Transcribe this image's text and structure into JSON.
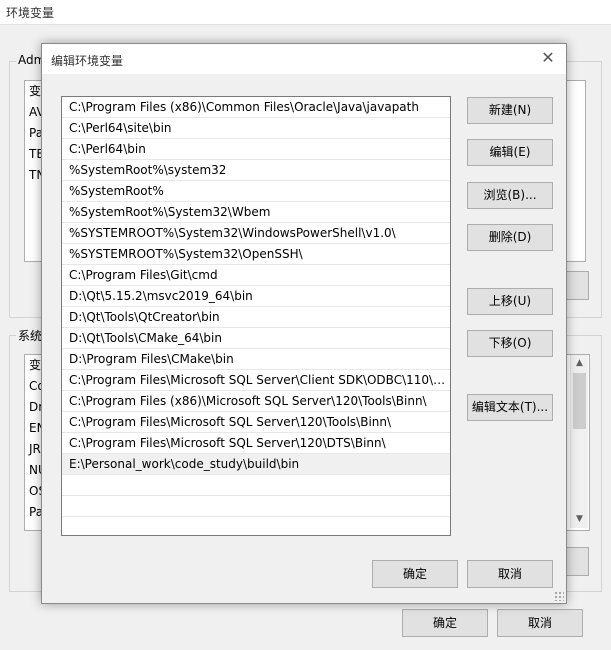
{
  "parent_window": {
    "title": "环境变量",
    "user_group_label": "Adm",
    "user_list": [
      "变",
      "AV",
      "Pa",
      "TE",
      "TN"
    ],
    "system_group_label": "系统",
    "system_list": [
      "变",
      "Co",
      "Dr",
      "EN",
      "JR",
      "NU",
      "OS",
      "Pa"
    ],
    "ok_label": "确定",
    "cancel_label": "取消"
  },
  "dialog": {
    "title": "编辑环境变量",
    "close_glyph": "✕",
    "paths": [
      "C:\\Program Files (x86)\\Common Files\\Oracle\\Java\\javapath",
      "C:\\Perl64\\site\\bin",
      "C:\\Perl64\\bin",
      "%SystemRoot%\\system32",
      "%SystemRoot%",
      "%SystemRoot%\\System32\\Wbem",
      "%SYSTEMROOT%\\System32\\WindowsPowerShell\\v1.0\\",
      "%SYSTEMROOT%\\System32\\OpenSSH\\",
      "C:\\Program Files\\Git\\cmd",
      "D:\\Qt\\5.15.2\\msvc2019_64\\bin",
      "D:\\Qt\\Tools\\QtCreator\\bin",
      "D:\\Qt\\Tools\\CMake_64\\bin",
      "D:\\Program Files\\CMake\\bin",
      "C:\\Program Files\\Microsoft SQL Server\\Client SDK\\ODBC\\110\\T...",
      "C:\\Program Files (x86)\\Microsoft SQL Server\\120\\Tools\\Binn\\",
      "C:\\Program Files\\Microsoft SQL Server\\120\\Tools\\Binn\\",
      "C:\\Program Files\\Microsoft SQL Server\\120\\DTS\\Binn\\",
      "E:\\Personal_work\\code_study\\build\\bin"
    ],
    "buttons": {
      "new": "新建(N)",
      "edit": "编辑(E)",
      "browse": "浏览(B)...",
      "delete": "删除(D)",
      "move_up": "上移(U)",
      "move_down": "下移(O)",
      "edit_text": "编辑文本(T)...",
      "ok": "确定",
      "cancel": "取消"
    }
  }
}
